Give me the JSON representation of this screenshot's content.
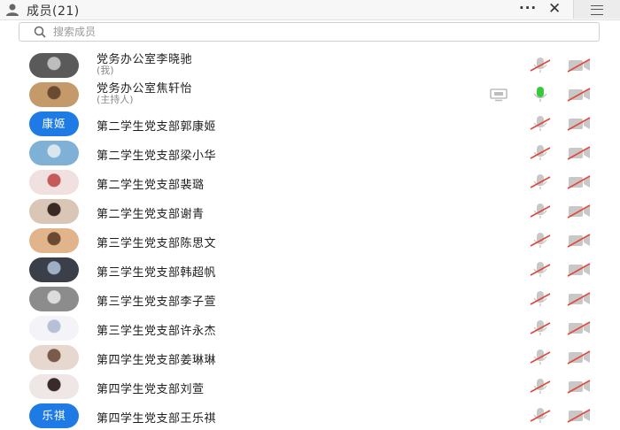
{
  "header": {
    "title": "成员(21)",
    "more_icon": "more-icon",
    "close_icon": "close-icon",
    "sidebar_toggle_icon": "menu-icon"
  },
  "search": {
    "placeholder": "搜索成员",
    "value": ""
  },
  "colors": {
    "avatar_blue": "#1e7be6",
    "mic_active": "#39c93c",
    "muted_red": "#e0483e",
    "icon_gray": "#c8c8c8"
  },
  "members": [
    {
      "name": "党务办公室李晓驰",
      "sub": "(我)",
      "avatar": "photo",
      "mic": "muted",
      "cam": "off"
    },
    {
      "name": "党务办公室焦轩怡",
      "sub": "(主持人)",
      "avatar": "photo",
      "mic": "active",
      "cam": "off",
      "sharing": true
    },
    {
      "name": "第二学生党支部郭康姬",
      "avatar": "text",
      "avatar_text": "康姬",
      "mic": "muted",
      "cam": "off"
    },
    {
      "name": "第二学生党支部梁小华",
      "avatar": "photo",
      "mic": "muted",
      "cam": "off"
    },
    {
      "name": "第二学生党支部裴璐",
      "avatar": "photo",
      "mic": "muted",
      "cam": "off"
    },
    {
      "name": "第二学生党支部谢青",
      "avatar": "photo",
      "mic": "muted",
      "cam": "off"
    },
    {
      "name": "第三学生党支部陈思文",
      "avatar": "photo",
      "mic": "muted",
      "cam": "off"
    },
    {
      "name": "第三学生党支部韩超帆",
      "avatar": "photo",
      "mic": "muted",
      "cam": "off"
    },
    {
      "name": "第三学生党支部李子萱",
      "avatar": "photo",
      "mic": "muted",
      "cam": "off"
    },
    {
      "name": "第三学生党支部许永杰",
      "avatar": "photo",
      "mic": "muted",
      "cam": "off"
    },
    {
      "name": "第四学生党支部姜琳琳",
      "avatar": "photo",
      "mic": "muted",
      "cam": "off"
    },
    {
      "name": "第四学生党支部刘萱",
      "avatar": "photo",
      "mic": "muted",
      "cam": "off"
    },
    {
      "name": "第四学生党支部王乐祺",
      "avatar": "text",
      "avatar_text": "乐祺",
      "mic": "muted",
      "cam": "off"
    }
  ]
}
